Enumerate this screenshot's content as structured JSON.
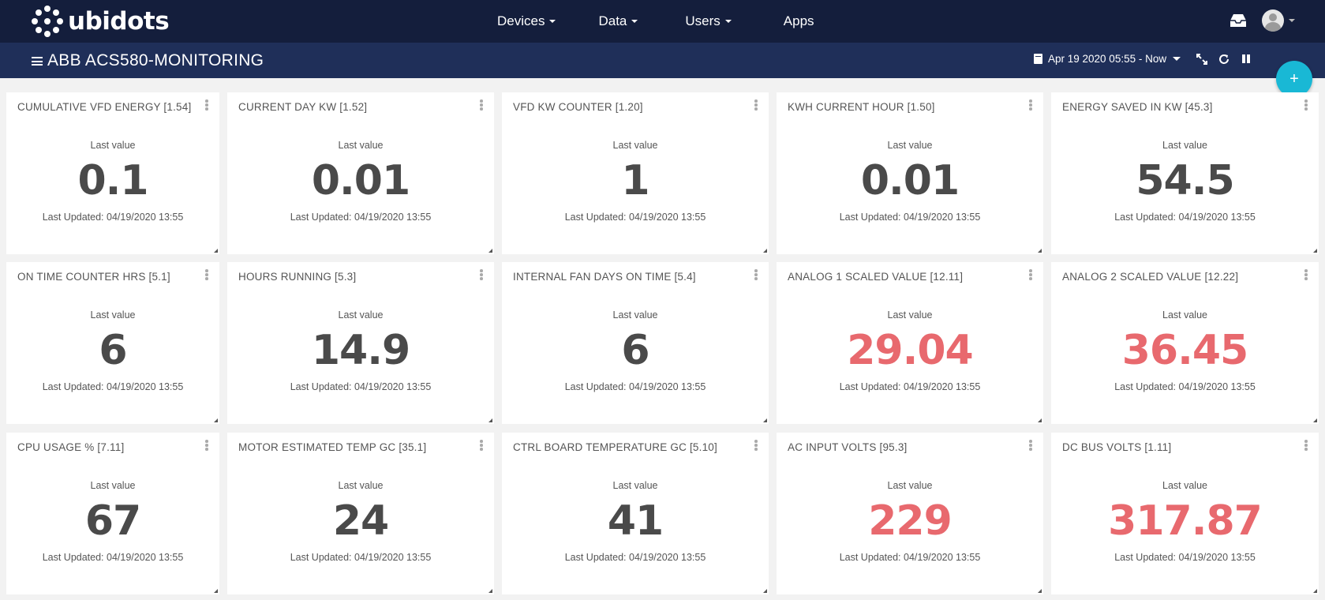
{
  "brand": {
    "name": "ubidots"
  },
  "nav": {
    "items": [
      {
        "label": "Devices",
        "has_caret": true
      },
      {
        "label": "Data",
        "has_caret": true
      },
      {
        "label": "Users",
        "has_caret": true
      },
      {
        "label": "Apps",
        "has_caret": false
      }
    ]
  },
  "dashboard": {
    "title": "ABB ACS580-MONITORING",
    "date_range": "Apr 19 2020 05:55 - Now"
  },
  "fab": {
    "label": "+"
  },
  "colors": {
    "alert": "#e8696e",
    "normal": "#4a4a4a",
    "accent": "#19b8d5"
  },
  "widgets": [
    {
      "title": "CUMULATIVE VFD ENERGY [1.54]",
      "label": "Last value",
      "value": "0.1",
      "updated": "Last Updated: 04/19/2020 13:55",
      "alert": false
    },
    {
      "title": "CURRENT DAY KW [1.52]",
      "label": "Last value",
      "value": "0.01",
      "updated": "Last Updated: 04/19/2020 13:55",
      "alert": false
    },
    {
      "title": "VFD KW COUNTER [1.20]",
      "label": "Last value",
      "value": "1",
      "updated": "Last Updated: 04/19/2020 13:55",
      "alert": false
    },
    {
      "title": "KWH CURRENT HOUR [1.50]",
      "label": "Last value",
      "value": "0.01",
      "updated": "Last Updated: 04/19/2020 13:55",
      "alert": false
    },
    {
      "title": "ENERGY SAVED IN KW [45.3]",
      "label": "Last value",
      "value": "54.5",
      "updated": "Last Updated: 04/19/2020 13:55",
      "alert": false
    },
    {
      "title": "ON TIME COUNTER HRS [5.1]",
      "label": "Last value",
      "value": "6",
      "updated": "Last Updated: 04/19/2020 13:55",
      "alert": false
    },
    {
      "title": "HOURS RUNNING [5.3]",
      "label": "Last value",
      "value": "14.9",
      "updated": "Last Updated: 04/19/2020 13:55",
      "alert": false
    },
    {
      "title": "INTERNAL FAN DAYS ON TIME [5.4]",
      "label": "Last value",
      "value": "6",
      "updated": "Last Updated: 04/19/2020 13:55",
      "alert": false
    },
    {
      "title": "ANALOG 1 SCALED VALUE [12.11]",
      "label": "Last value",
      "value": "29.04",
      "updated": "Last Updated: 04/19/2020 13:55",
      "alert": true
    },
    {
      "title": "ANALOG 2 SCALED VALUE [12.22]",
      "label": "Last value",
      "value": "36.45",
      "updated": "Last Updated: 04/19/2020 13:55",
      "alert": true
    },
    {
      "title": "CPU USAGE % [7.11]",
      "label": "Last value",
      "value": "67",
      "updated": "Last Updated: 04/19/2020 13:55",
      "alert": false
    },
    {
      "title": "MOTOR ESTIMATED TEMP GC [35.1]",
      "label": "Last value",
      "value": "24",
      "updated": "Last Updated: 04/19/2020 13:55",
      "alert": false
    },
    {
      "title": "CTRL BOARD TEMPERATURE GC [5.10]",
      "label": "Last value",
      "value": "41",
      "updated": "Last Updated: 04/19/2020 13:55",
      "alert": false
    },
    {
      "title": "AC INPUT VOLTS [95.3]",
      "label": "Last value",
      "value": "229",
      "updated": "Last Updated: 04/19/2020 13:55",
      "alert": true
    },
    {
      "title": "DC BUS VOLTS [1.11]",
      "label": "Last value",
      "value": "317.87",
      "updated": "Last Updated: 04/19/2020 13:55",
      "alert": true
    }
  ]
}
